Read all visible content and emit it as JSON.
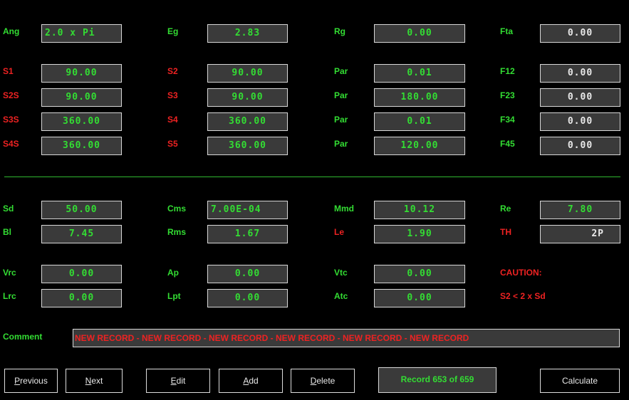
{
  "rows_top": [
    {
      "labels": [
        "Ang",
        "Eg",
        "Rg",
        "Fta"
      ],
      "label_colors": [
        "g",
        "g",
        "g",
        "g"
      ],
      "values": [
        "2.0 x Pi",
        "2.83",
        "0.00",
        "0.00"
      ]
    },
    {
      "labels": [
        "S1",
        "S2",
        "Par",
        "F12"
      ],
      "label_colors": [
        "r",
        "r",
        "g",
        "g"
      ],
      "values": [
        "90.00",
        "90.00",
        "0.01",
        "0.00"
      ]
    },
    {
      "labels": [
        "S2S",
        "S3",
        "Par",
        "F23"
      ],
      "label_colors": [
        "r",
        "r",
        "g",
        "g"
      ],
      "values": [
        "90.00",
        "90.00",
        "180.00",
        "0.00"
      ]
    },
    {
      "labels": [
        "S3S",
        "S4",
        "Par",
        "F34"
      ],
      "label_colors": [
        "r",
        "r",
        "g",
        "g"
      ],
      "values": [
        "360.00",
        "360.00",
        "0.01",
        "0.00"
      ]
    },
    {
      "labels": [
        "S4S",
        "S5",
        "Par",
        "F45"
      ],
      "label_colors": [
        "r",
        "r",
        "g",
        "g"
      ],
      "values": [
        "360.00",
        "360.00",
        "120.00",
        "0.00"
      ]
    }
  ],
  "rows_bottom": {
    "sd": {
      "label": "Sd",
      "value": "50.00"
    },
    "bl": {
      "label": "Bl",
      "value": "7.45"
    },
    "vrc": {
      "label": "Vrc",
      "value": "0.00"
    },
    "lrc": {
      "label": "Lrc",
      "value": "0.00"
    },
    "cms": {
      "label": "Cms",
      "value": "7.00E-04"
    },
    "rms": {
      "label": "Rms",
      "value": "1.67"
    },
    "ap": {
      "label": "Ap",
      "value": "0.00"
    },
    "lpt": {
      "label": "Lpt",
      "value": "0.00"
    },
    "mmd": {
      "label": "Mmd",
      "value": "10.12"
    },
    "le": {
      "label": "Le",
      "value": "1.90"
    },
    "vtc": {
      "label": "Vtc",
      "value": "0.00"
    },
    "atc": {
      "label": "Atc",
      "value": "0.00"
    },
    "re": {
      "label": "Re",
      "value": "7.80"
    },
    "th": {
      "label": "TH",
      "value": "2P"
    },
    "caution_title": "CAUTION:",
    "caution_text": "S2 < 2 x Sd"
  },
  "comment": {
    "label": "Comment",
    "value": "NEW RECORD - NEW RECORD - NEW RECORD - NEW RECORD - NEW RECORD - NEW RECORD"
  },
  "buttons": {
    "previous": {
      "first": "P",
      "rest": "revious"
    },
    "next": {
      "first": "N",
      "rest": "ext"
    },
    "edit": {
      "first": "E",
      "rest": "dit"
    },
    "add": {
      "first": "A",
      "rest": "dd"
    },
    "delete": {
      "first": "D",
      "rest": "elete"
    },
    "calculate": "Calculate"
  },
  "record_status": "Record 653 of 659",
  "colors": {
    "green": "#33dd33",
    "red": "#ee2222",
    "field_bg": "#3a3a3a",
    "background": "#000000"
  }
}
